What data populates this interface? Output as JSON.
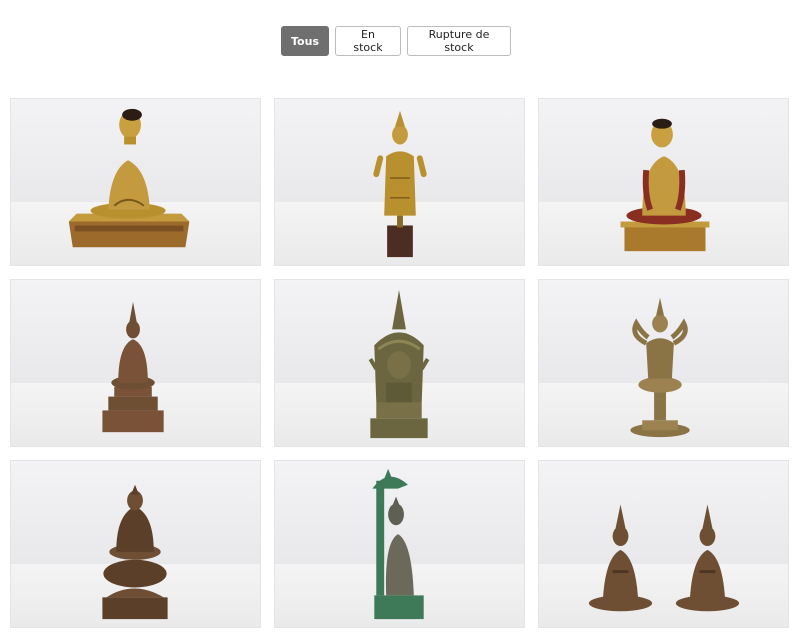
{
  "filters": [
    {
      "label": "Tous",
      "active": true
    },
    {
      "label": "En stock",
      "active": false
    },
    {
      "label": "Rupture de stock",
      "active": false
    }
  ],
  "products": [
    {
      "variant": "seated-gold-plinth"
    },
    {
      "variant": "standing-gold"
    },
    {
      "variant": "seated-gold-monk"
    },
    {
      "variant": "seated-bronze-tiered"
    },
    {
      "variant": "crowned-shrine"
    },
    {
      "variant": "deity-trident"
    },
    {
      "variant": "seated-bronze-lotus"
    },
    {
      "variant": "naga-canopy"
    },
    {
      "variant": "twin-guardians"
    }
  ],
  "colors": {
    "gold": "#b8902e",
    "gold_dark": "#7a5a1c",
    "bronze": "#6e4f34",
    "bronze_green": "#6b6640",
    "verdigris": "#3e7a58",
    "wood": "#4b2d22"
  }
}
